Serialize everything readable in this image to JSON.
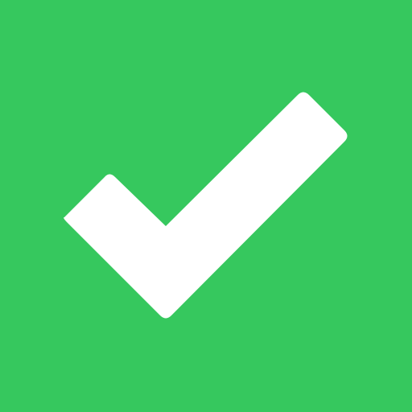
{
  "icon": {
    "name": "checkmark-icon",
    "background_color": "#36c85e",
    "glyph_color": "#ffffff"
  }
}
